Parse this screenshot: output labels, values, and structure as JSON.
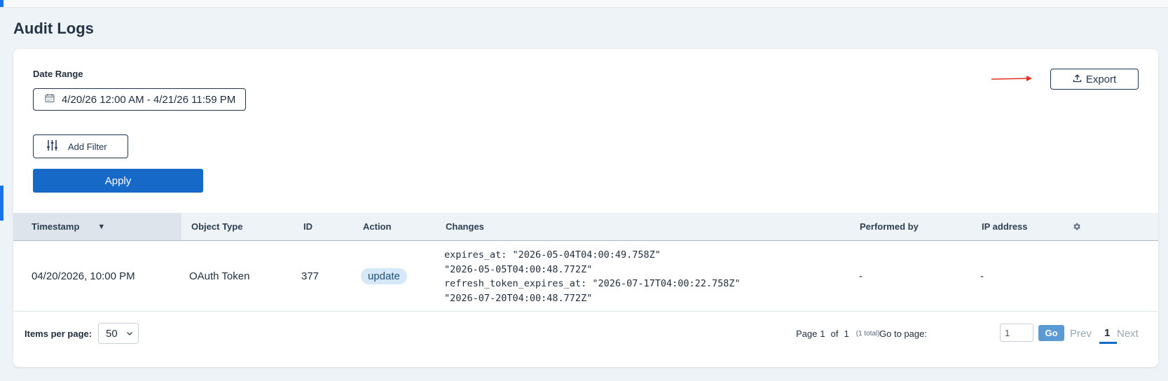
{
  "page": {
    "title": "Audit Logs"
  },
  "filters": {
    "date_range_label": "Date Range",
    "date_range_value": "4/20/26 12:00 AM - 4/21/26 11:59 PM",
    "add_filter_label": "Add Filter",
    "apply_label": "Apply",
    "export_label": "Export"
  },
  "table": {
    "columns": [
      "Timestamp",
      "Object Type",
      "ID",
      "Action",
      "Changes",
      "Performed by",
      "IP address"
    ],
    "sort_indicator": "▼",
    "rows": [
      {
        "timestamp": "04/20/2026, 10:00 PM",
        "object_type": "OAuth Token",
        "id": "377",
        "action": "update",
        "changes": "expires_at: \"2026-05-04T04:00:49.758Z\"\n\"2026-05-05T04:00:48.772Z\"\nrefresh_token_expires_at: \"2026-07-17T04:00:22.758Z\"\n\"2026-07-20T04:00:48.772Z\"",
        "performed_by": "-",
        "ip_address": "-"
      }
    ]
  },
  "pagination": {
    "items_per_page_label": "Items per page:",
    "items_per_page_value": "50",
    "page_word": "Page",
    "current_page": "1",
    "of_word": "of",
    "total_pages": "1",
    "total_note": "(1 total)",
    "goto_label": "Go to page:",
    "goto_value": "1",
    "go_label": "Go",
    "prev_label": "Prev",
    "page_number": "1",
    "next_label": "Next"
  },
  "icons": {
    "calendar": "calendar-icon",
    "upload": "upload-icon",
    "filter": "sliders-icon",
    "settings": "gear-icon",
    "chevron": "chevron-down-icon"
  },
  "colors": {
    "primary": "#1769c7",
    "badge_bg": "#d6e8f7",
    "annotation": "#e0301e"
  }
}
